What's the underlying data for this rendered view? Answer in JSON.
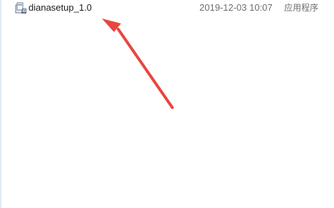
{
  "file_list": {
    "items": [
      {
        "name": "dianasetup_1.0",
        "date_modified": "2019-12-03 10:07",
        "type": "应用程序",
        "icon": "installer-icon"
      }
    ]
  },
  "annotation": {
    "arrow_color": "#e8463f"
  }
}
